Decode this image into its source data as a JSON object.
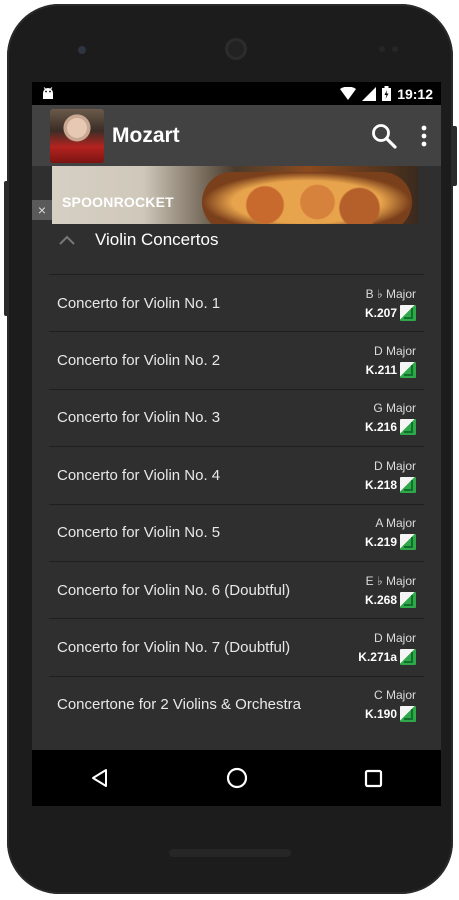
{
  "status_bar": {
    "time": "19:12"
  },
  "app_bar": {
    "title": "Mozart"
  },
  "ad": {
    "brand": "SPOONROCKET",
    "close_label": "×"
  },
  "section": {
    "title": "Violin Concertos"
  },
  "works": [
    {
      "title": "Concerto for Violin No. 1",
      "key": "B ♭ Major",
      "kochel": "K.207"
    },
    {
      "title": "Concerto for Violin No. 2",
      "key": "D Major",
      "kochel": "K.211"
    },
    {
      "title": "Concerto for Violin No. 3",
      "key": "G Major",
      "kochel": "K.216"
    },
    {
      "title": "Concerto for Violin No. 4",
      "key": "D Major",
      "kochel": "K.218"
    },
    {
      "title": "Concerto for Violin No. 5",
      "key": "A Major",
      "kochel": "K.219"
    },
    {
      "title": "Concerto for Violin No. 6 (Doubtful)",
      "key": "E ♭ Major",
      "kochel": "K.268"
    },
    {
      "title": "Concerto for Violin No. 7 (Doubtful)",
      "key": "D Major",
      "kochel": "K.271a"
    },
    {
      "title": "Concertone for 2 Violins & Orchestra",
      "key": "C Major",
      "kochel": "K.190"
    }
  ],
  "colors": {
    "background": "#2f2f2f",
    "app_bar": "#424242",
    "divider": "#1f1f1f",
    "badge_green": "#2fa84a"
  }
}
